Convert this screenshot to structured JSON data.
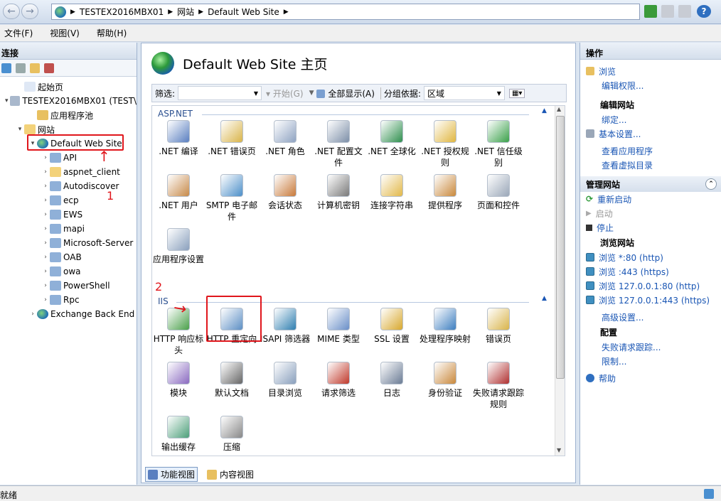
{
  "address": {
    "segments": [
      "TESTEX2016MBX01",
      "网站",
      "Default Web Site"
    ]
  },
  "menu": [
    "文件(F)",
    "视图(V)",
    "帮助(H)"
  ],
  "left": {
    "header": "连接",
    "tree": [
      {
        "label": "起始页",
        "indent": 1,
        "twisty": "",
        "icon": "page"
      },
      {
        "label": "TESTEX2016MBX01 (TEST\\",
        "indent": 0,
        "twisty": "▾",
        "icon": "server"
      },
      {
        "label": "应用程序池",
        "indent": 2,
        "twisty": "",
        "icon": "pool"
      },
      {
        "label": "网站",
        "indent": 1,
        "twisty": "▾",
        "icon": "folder"
      },
      {
        "label": "Default Web Site",
        "indent": 2,
        "twisty": "▾",
        "icon": "globe"
      },
      {
        "label": "API",
        "indent": 3,
        "twisty": "›",
        "icon": "app"
      },
      {
        "label": "aspnet_client",
        "indent": 3,
        "twisty": "›",
        "icon": "folder"
      },
      {
        "label": "Autodiscover",
        "indent": 3,
        "twisty": "›",
        "icon": "app"
      },
      {
        "label": "ecp",
        "indent": 3,
        "twisty": "›",
        "icon": "app"
      },
      {
        "label": "EWS",
        "indent": 3,
        "twisty": "›",
        "icon": "app"
      },
      {
        "label": "mapi",
        "indent": 3,
        "twisty": "›",
        "icon": "app"
      },
      {
        "label": "Microsoft-Server",
        "indent": 3,
        "twisty": "›",
        "icon": "app"
      },
      {
        "label": "OAB",
        "indent": 3,
        "twisty": "›",
        "icon": "app"
      },
      {
        "label": "owa",
        "indent": 3,
        "twisty": "›",
        "icon": "app"
      },
      {
        "label": "PowerShell",
        "indent": 3,
        "twisty": "›",
        "icon": "app"
      },
      {
        "label": "Rpc",
        "indent": 3,
        "twisty": "›",
        "icon": "app"
      },
      {
        "label": "Exchange Back End",
        "indent": 2,
        "twisty": "›",
        "icon": "globe"
      }
    ]
  },
  "center": {
    "title": "Default Web Site 主页",
    "filter_label": "筛选:",
    "start_label": "开始(G)",
    "showall_label": "全部显示(A)",
    "groupby_label": "分组依据:",
    "groupby_value": "区域",
    "groups": [
      {
        "name": "ASP.NET",
        "items": [
          {
            "label": ".NET 编译",
            "icon": "dotnet-compile-icon",
            "color": "#5a7fc0"
          },
          {
            "label": ".NET 错误页",
            "icon": "dotnet-error-page-icon",
            "color": "#d9b44a"
          },
          {
            "label": ".NET 角色",
            "icon": "dotnet-roles-icon",
            "color": "#8fa3c2"
          },
          {
            "label": ".NET 配置文件",
            "icon": "dotnet-profile-icon",
            "color": "#7d8fa8"
          },
          {
            "label": ".NET 全球化",
            "icon": "dotnet-globalization-icon",
            "color": "#2f8f4e"
          },
          {
            "label": ".NET 授权规则",
            "icon": "dotnet-authorization-icon",
            "color": "#e0b640"
          },
          {
            "label": ".NET 信任级别",
            "icon": "dotnet-trust-icon",
            "color": "#3aa04a"
          },
          {
            "label": ".NET 用户",
            "icon": "dotnet-users-icon",
            "color": "#c78a4a"
          },
          {
            "label": "SMTP 电子邮件",
            "icon": "smtp-icon",
            "color": "#4c8fc9"
          },
          {
            "label": "会话状态",
            "icon": "session-state-icon",
            "color": "#c87a3a"
          },
          {
            "label": "计算机密钥",
            "icon": "machine-key-icon",
            "color": "#7a7a7a"
          },
          {
            "label": "连接字符串",
            "icon": "connection-strings-icon",
            "color": "#e2b84a"
          },
          {
            "label": "提供程序",
            "icon": "providers-icon",
            "color": "#c9893c"
          },
          {
            "label": "页面和控件",
            "icon": "pages-controls-icon",
            "color": "#9aa7b8"
          },
          {
            "label": "应用程序设置",
            "icon": "app-settings-icon",
            "color": "#8aa0bd"
          }
        ]
      },
      {
        "name": "IIS",
        "items": [
          {
            "label": "HTTP 响应标头",
            "icon": "http-headers-icon",
            "color": "#4aa04a"
          },
          {
            "label": "HTTP 重定向",
            "icon": "http-redirect-icon",
            "color": "#5d8fc4"
          },
          {
            "label": "ISAPI 筛选器",
            "icon": "isapi-filters-icon",
            "color": "#2f7fb0"
          },
          {
            "label": "MIME 类型",
            "icon": "mime-types-icon",
            "color": "#6a8fc8"
          },
          {
            "label": "SSL 设置",
            "icon": "ssl-lock-icon",
            "color": "#d8a82e"
          },
          {
            "label": "处理程序映射",
            "icon": "handler-mappings-icon",
            "color": "#3e7fc0"
          },
          {
            "label": "错误页",
            "icon": "error-pages-icon",
            "color": "#d9b44a"
          },
          {
            "label": "模块",
            "icon": "modules-icon",
            "color": "#8a6ac0"
          },
          {
            "label": "默认文档",
            "icon": "default-document-icon",
            "color": "#666"
          },
          {
            "label": "目录浏览",
            "icon": "directory-browsing-icon",
            "color": "#8aa0bd"
          },
          {
            "label": "请求筛选",
            "icon": "request-filtering-icon",
            "color": "#c0392b"
          },
          {
            "label": "日志",
            "icon": "logging-icon",
            "color": "#6b7c95"
          },
          {
            "label": "身份验证",
            "icon": "authentication-icon",
            "color": "#c9893c"
          },
          {
            "label": "失败请求跟踪规则",
            "icon": "failed-request-tracing-icon",
            "color": "#b03030"
          },
          {
            "label": "输出缓存",
            "icon": "output-cache-icon",
            "color": "#4c9f7a"
          },
          {
            "label": "压缩",
            "icon": "compression-icon",
            "color": "#888"
          }
        ]
      }
    ],
    "views": [
      "功能视图",
      "内容视图"
    ]
  },
  "actions": {
    "header": "操作",
    "explore": "浏览",
    "edit_perms": "编辑权限...",
    "edit_site": "编辑网站",
    "bindings": "绑定...",
    "basic_settings": "基本设置...",
    "view_apps": "查看应用程序",
    "view_vdirs": "查看虚拟目录",
    "manage_site": "管理网站",
    "restart": "重新启动",
    "start": "启动",
    "stop": "停止",
    "browse_site": "浏览网站",
    "browse_links": [
      "浏览 *:80 (http)",
      "浏览 :443 (https)",
      "浏览 127.0.0.1:80 (http)",
      "浏览 127.0.0.1:443 (https)"
    ],
    "advanced": "高级设置...",
    "config": "配置",
    "fail_trace": "失败请求跟踪...",
    "limits": "限制...",
    "help": "帮助"
  },
  "status": "就绪",
  "annotations": {
    "one": "1",
    "two": "2"
  }
}
